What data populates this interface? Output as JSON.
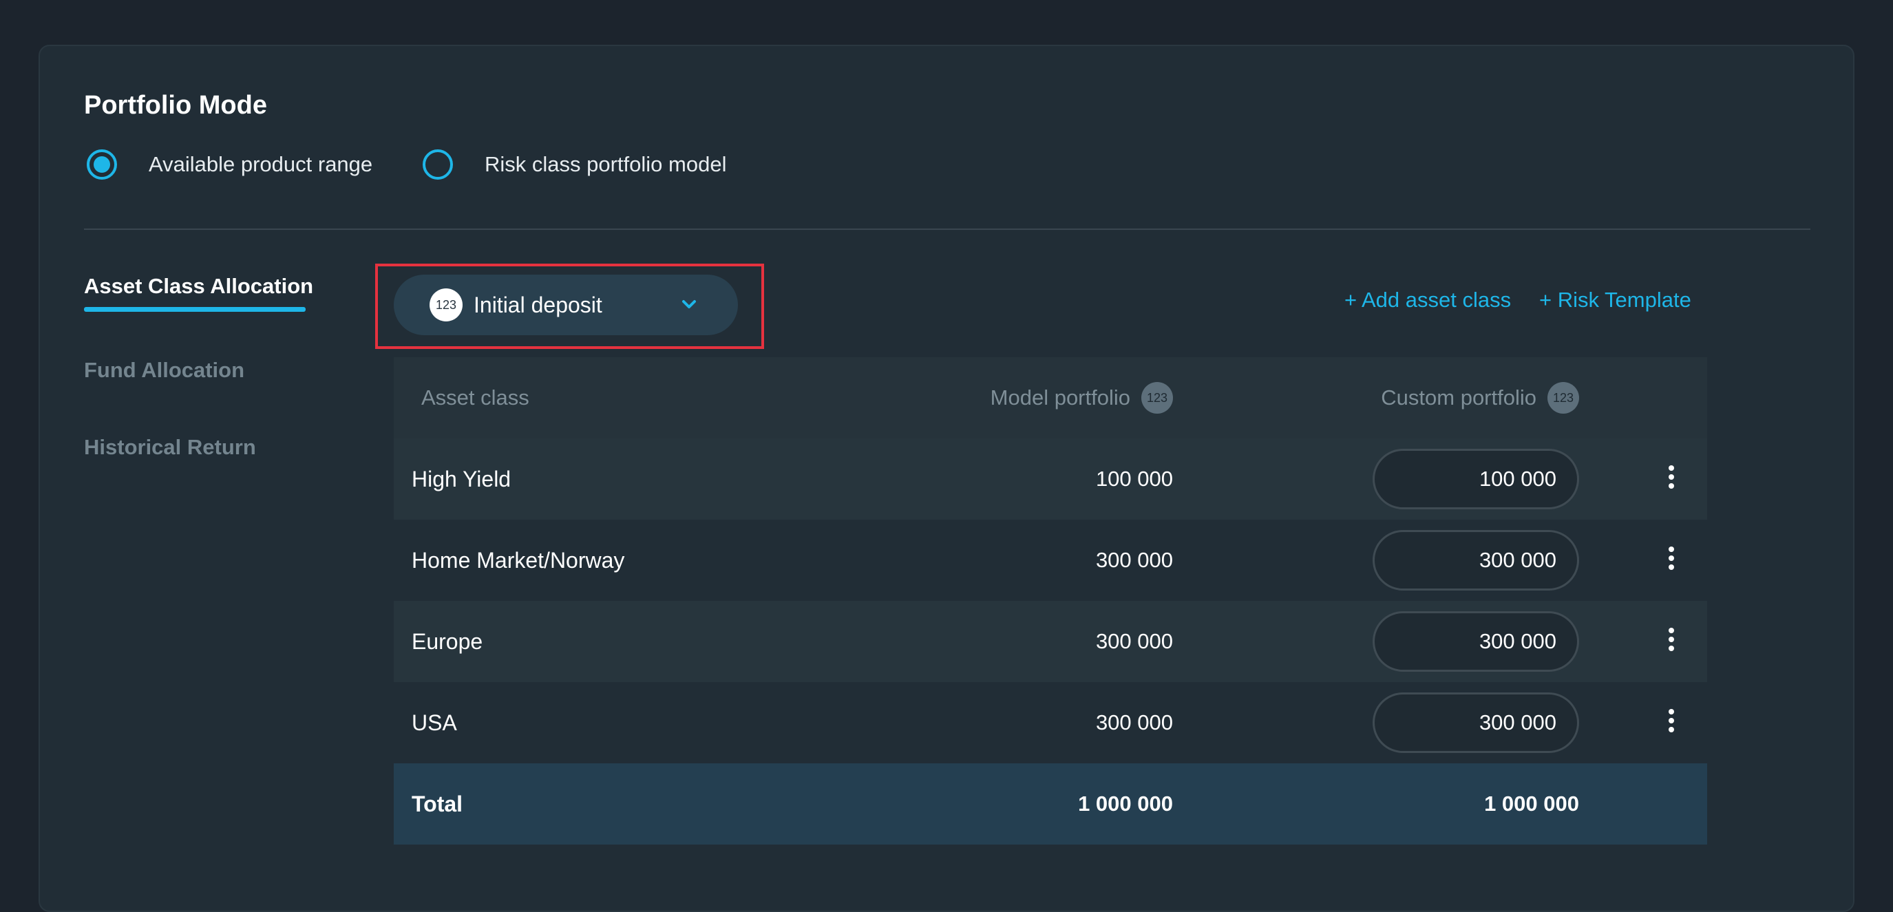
{
  "section_title": "Portfolio Mode",
  "portfolio_mode": {
    "options": [
      {
        "label": "Available product range",
        "selected": true
      },
      {
        "label": "Risk class portfolio model",
        "selected": false
      }
    ]
  },
  "sidenav": {
    "items": [
      {
        "label": "Asset Class Allocation",
        "active": true
      },
      {
        "label": "Fund Allocation",
        "active": false
      },
      {
        "label": "Historical Return",
        "active": false
      }
    ]
  },
  "deposit_select": {
    "badge": "123",
    "value": "Initial deposit",
    "icon": "chevron-down-icon"
  },
  "actions": {
    "add_asset_class": "+ Add asset class",
    "risk_template": "+ Risk Template"
  },
  "table": {
    "headers": {
      "asset_class": "Asset class",
      "model_portfolio": "Model portfolio",
      "custom_portfolio": "Custom portfolio",
      "badge": "123"
    },
    "rows": [
      {
        "name": "High Yield",
        "model": "100 000",
        "custom": "100 000"
      },
      {
        "name": "Home Market/Norway",
        "model": "300 000",
        "custom": "300 000"
      },
      {
        "name": "Europe",
        "model": "300 000",
        "custom": "300 000"
      },
      {
        "name": "USA",
        "model": "300 000",
        "custom": "300 000"
      }
    ],
    "total": {
      "label": "Total",
      "model": "1 000 000",
      "custom": "1 000 000"
    }
  },
  "colors": {
    "accent": "#1eb6e8",
    "highlight": "#e5323f",
    "background": "#1c242d",
    "card": "#212d36"
  }
}
